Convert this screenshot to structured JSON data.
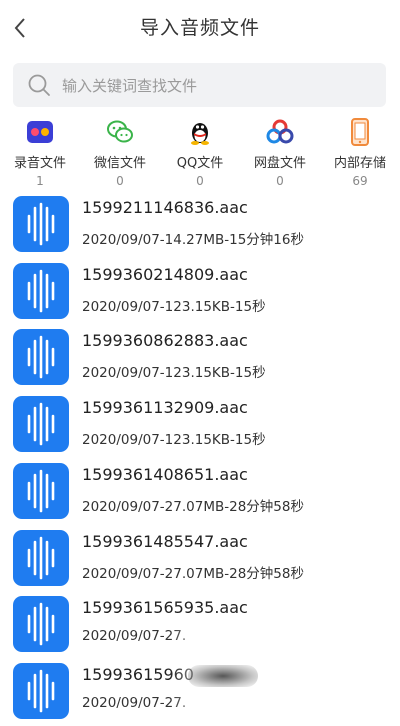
{
  "header": {
    "title": "导入音频文件",
    "back_icon": "chevron-left-icon"
  },
  "search": {
    "placeholder": "输入关键词查找文件",
    "icon": "search-icon"
  },
  "categories": [
    {
      "label": "录音文件",
      "count": "1",
      "icon": "recorder-icon"
    },
    {
      "label": "微信文件",
      "count": "0",
      "icon": "wechat-icon"
    },
    {
      "label": "QQ文件",
      "count": "0",
      "icon": "qq-penguin-icon"
    },
    {
      "label": "网盘文件",
      "count": "0",
      "icon": "cloud-drive-icon"
    },
    {
      "label": "内部存储",
      "count": "69",
      "icon": "phone-storage-icon"
    }
  ],
  "files": [
    {
      "name": "1599211146836.aac",
      "meta": "2020/09/07-14.27MB-15分钟16秒"
    },
    {
      "name": "1599360214809.aac",
      "meta": "2020/09/07-123.15KB-15秒"
    },
    {
      "name": "1599360862883.aac",
      "meta": "2020/09/07-123.15KB-15秒"
    },
    {
      "name": "1599361132909.aac",
      "meta": "2020/09/07-123.15KB-15秒"
    },
    {
      "name": "1599361408651.aac",
      "meta": "2020/09/07-27.07MB-28分钟58秒"
    },
    {
      "name": "1599361485547.aac",
      "meta": "2020/09/07-27.07MB-28分钟58秒"
    },
    {
      "name": "1599361565935.aac",
      "meta": "2020/09/07-27."
    },
    {
      "name": "15993615960",
      "meta": "2020/09/07-27."
    }
  ],
  "colors": {
    "file_icon_bg": "#1f7cf0",
    "search_bg": "#f1f2f4"
  }
}
